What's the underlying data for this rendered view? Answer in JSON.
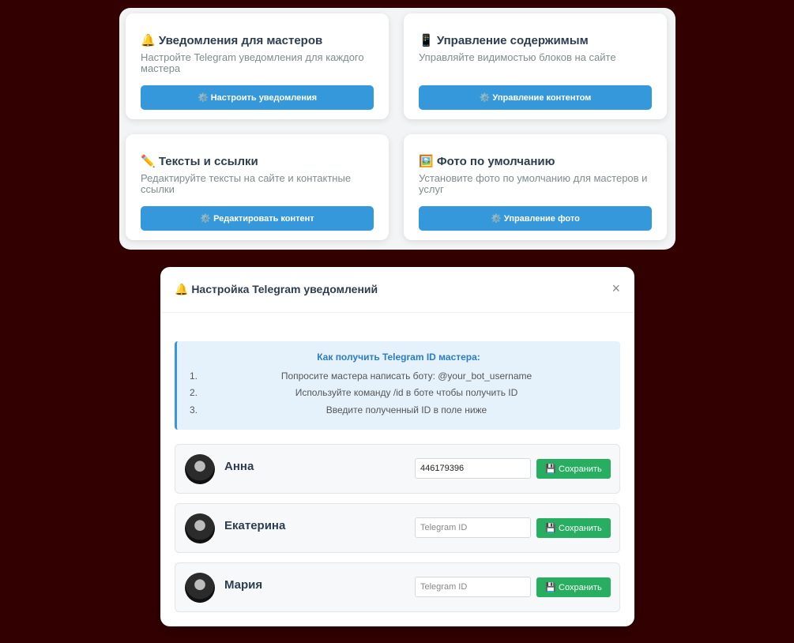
{
  "cards": [
    {
      "icon": "🔔",
      "title": "Уведомления для мастеров",
      "desc": "Настройте Telegram уведомления для каждого мастера",
      "button": "⚙️ Настроить уведомления"
    },
    {
      "icon": "📱",
      "title": "Управление содержимым",
      "desc": "Управляйте видимостью блоков на сайте",
      "button": "⚙️ Управление контентом"
    },
    {
      "icon": "✏️",
      "title": "Тексты и ссылки",
      "desc": "Редактируйте тексты на сайте и контактные ссылки",
      "button": "⚙️ Редактировать контент"
    },
    {
      "icon": "🖼️",
      "title": "Фото по умолчанию",
      "desc": "Установите фото по умолчанию для мастеров и услуг",
      "button": "⚙️ Управление фото"
    }
  ],
  "modal": {
    "title": "🔔 Настройка Telegram уведомлений",
    "close": "×",
    "info": {
      "title": "Как получить Telegram ID мастера:",
      "steps": [
        {
          "num": "1.",
          "text": "Попросите мастера написать боту: @your_bot_username"
        },
        {
          "num": "2.",
          "text": "Используйте команду /id в боте чтобы получить ID"
        },
        {
          "num": "3.",
          "text": "Введите полученный ID в поле ниже"
        }
      ]
    },
    "masters": [
      {
        "name": "Анна",
        "telegram_id": "446179396",
        "placeholder": "Telegram ID",
        "save": "💾 Сохранить"
      },
      {
        "name": "Екатерина",
        "telegram_id": "",
        "placeholder": "Telegram ID",
        "save": "💾 Сохранить"
      },
      {
        "name": "Мария",
        "telegram_id": "",
        "placeholder": "Telegram ID",
        "save": "💾 Сохранить"
      }
    ]
  }
}
